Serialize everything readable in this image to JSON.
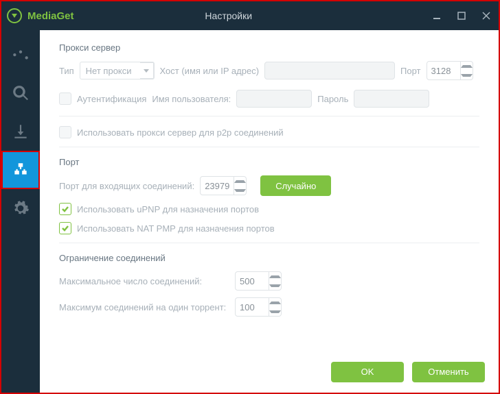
{
  "titlebar": {
    "brand": "MediaGet",
    "title": "Настройки"
  },
  "proxy": {
    "section_title": "Прокси сервер",
    "type_label": "Тип",
    "type_value": "Нет прокси",
    "host_label": "Хост (имя или IP адрес)",
    "host_value": "",
    "port_label": "Порт",
    "port_value": "3128",
    "auth_label": "Аутентификация",
    "user_label": "Имя пользователя:",
    "user_value": "",
    "password_label": "Пароль",
    "password_value": "",
    "p2p_label": "Использовать прокси сервер для p2p соединений"
  },
  "port": {
    "section_title": "Порт",
    "incoming_label": "Порт для входящих соединений:",
    "incoming_value": "23979",
    "random_btn": "Случайно",
    "upnp_label": "Использовать uPNP для назначения портов",
    "natpmp_label": "Использовать NAT PMP для назначения портов"
  },
  "limits": {
    "section_title": "Ограничение соединений",
    "max_conn_label": "Максимальное число соединений:",
    "max_conn_value": "500",
    "max_per_torrent_label": "Максимум соединений на один торрент:",
    "max_per_torrent_value": "100"
  },
  "footer": {
    "ok": "OK",
    "cancel": "Отменить"
  }
}
